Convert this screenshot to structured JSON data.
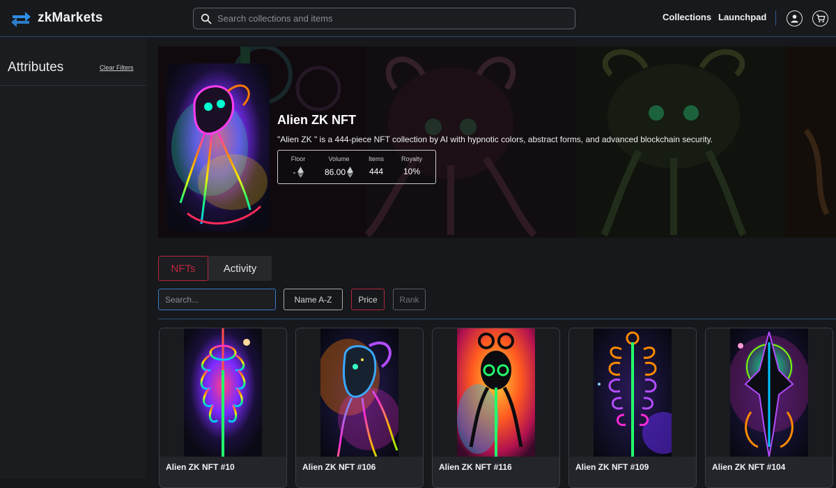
{
  "nav": {
    "brand": "zkMarkets",
    "search_placeholder": "Search collections and items",
    "links": [
      "Collections",
      "Launchpad"
    ],
    "icons": [
      "swap-arrows-icon",
      "search-icon",
      "user-icon",
      "cart-icon"
    ]
  },
  "sidebar": {
    "title": "Attributes",
    "clear_filters": "Clear Filters"
  },
  "collection": {
    "name": "Alien ZK NFT",
    "description": "\"Alien ZK \" is a 444-piece NFT collection by AI with hypnotic colors, abstract forms, and advanced blockchain security.",
    "stats": [
      {
        "label": "Floor",
        "value": "-",
        "icon": "eth-icon"
      },
      {
        "label": "Volume",
        "value": "86.00",
        "icon": "eth-icon"
      },
      {
        "label": "Items",
        "value": "444"
      },
      {
        "label": "Royalty",
        "value": "10%"
      }
    ]
  },
  "tabs": {
    "nfts": "NFTs",
    "activity": "Activity",
    "active": "NFTs"
  },
  "filters": {
    "search_placeholder": "Search...",
    "sort_name": "Name A-Z",
    "sort_price": "Price",
    "sort_rank": "Rank",
    "active_sort": "Price"
  },
  "items": [
    {
      "name": "Alien ZK NFT #10"
    },
    {
      "name": "Alien ZK NFT #106"
    },
    {
      "name": "Alien ZK NFT #116"
    },
    {
      "name": "Alien ZK NFT #109"
    },
    {
      "name": "Alien ZK NFT #104"
    }
  ],
  "colors": {
    "background": "#16181c",
    "accent_red": "#c02740",
    "accent_blue": "#3b7cc4",
    "brand_blue": "#2f8ee8"
  }
}
